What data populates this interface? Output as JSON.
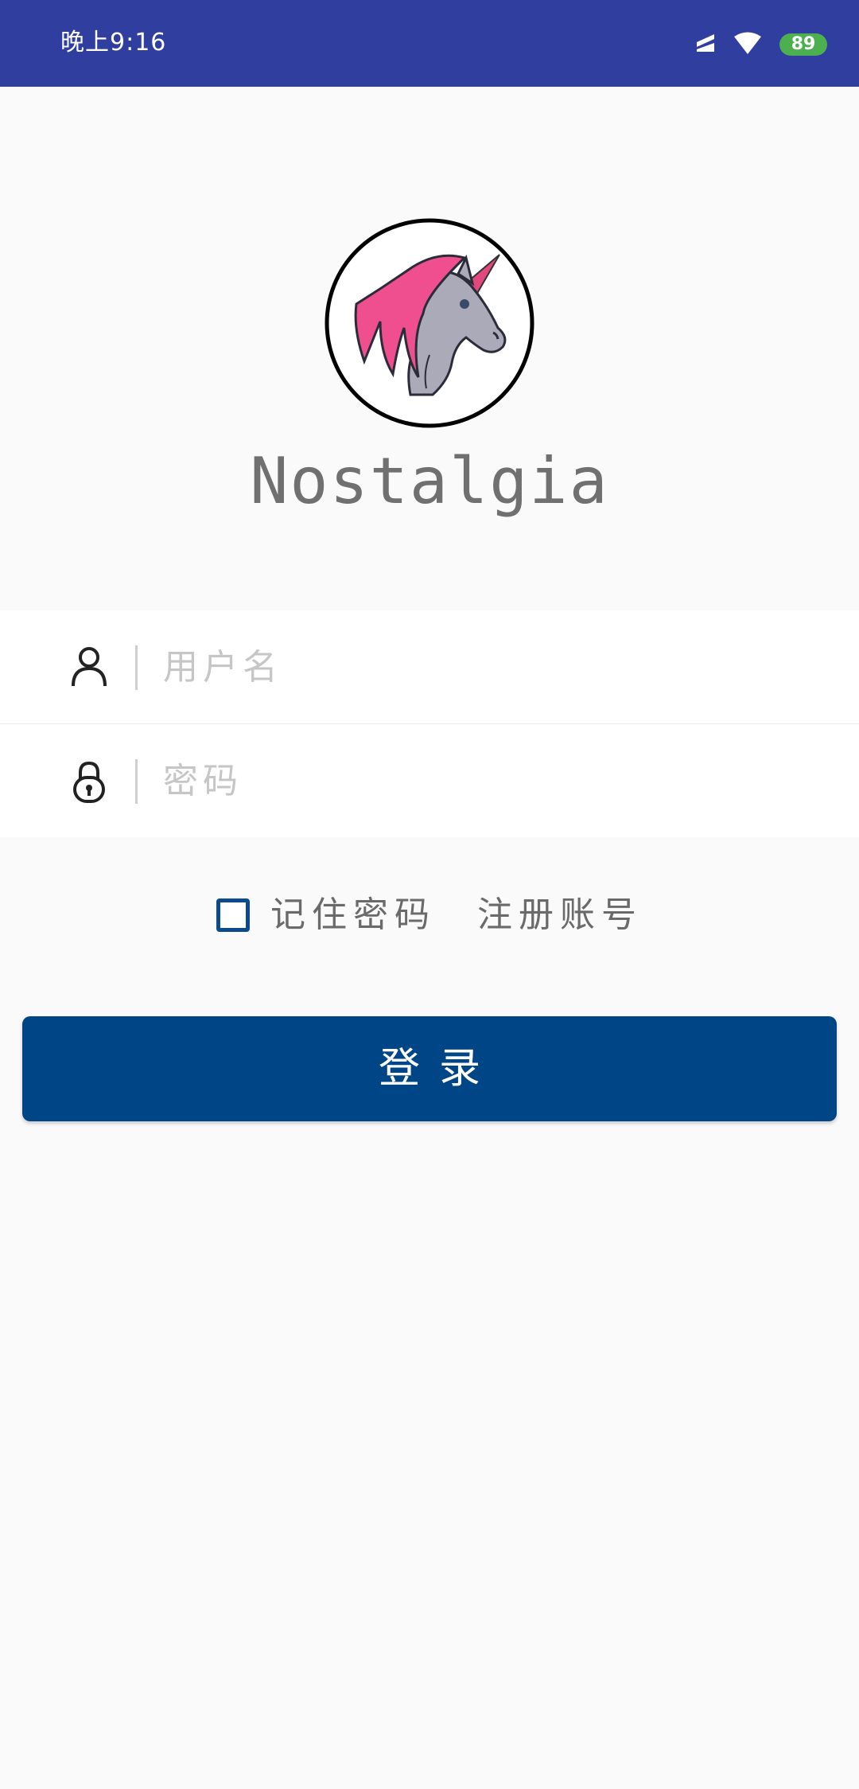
{
  "status_bar": {
    "time": "晚上9:16",
    "battery": "89",
    "icons": [
      "signal-icon",
      "wifi-icon",
      "battery-icon"
    ],
    "background_color": "#303f9f"
  },
  "app": {
    "logo": "unicorn-logo",
    "title": "Nostalgia"
  },
  "form": {
    "username": {
      "icon": "user-icon",
      "placeholder": "用户名",
      "value": ""
    },
    "password": {
      "icon": "lock-icon",
      "placeholder": "密码",
      "value": ""
    },
    "remember_label": "记住密码",
    "remember_checked": false,
    "register_label": "注册账号",
    "login_label": "登录",
    "login_color": "#004586"
  }
}
